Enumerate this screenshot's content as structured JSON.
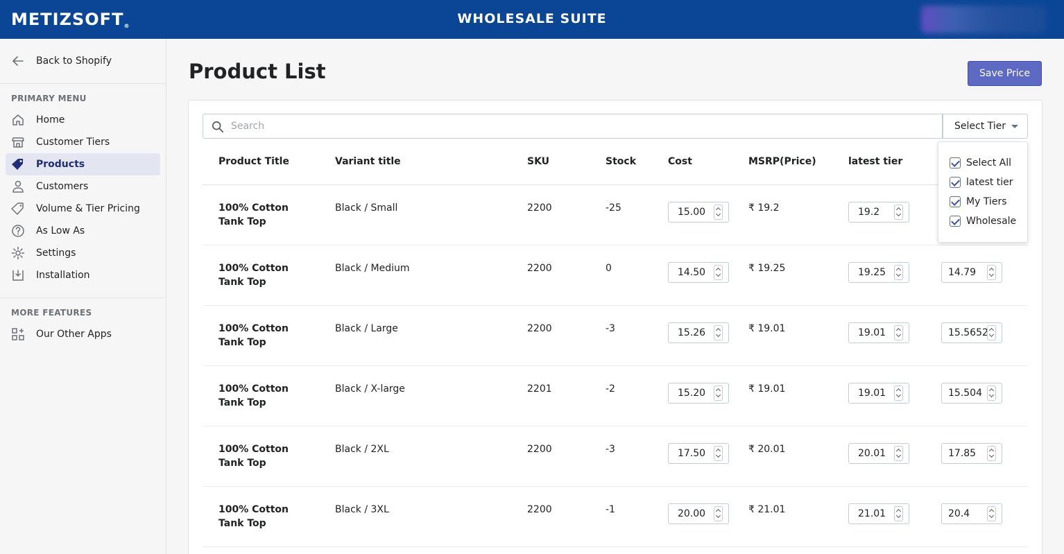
{
  "header": {
    "logo": "METIZSOFT",
    "logo_mark": "®",
    "title": "WHOLESALE SUITE"
  },
  "sidebar": {
    "back_label": "Back to Shopify",
    "primary_title": "PRIMARY MENU",
    "items": [
      {
        "label": "Home",
        "icon": "home-icon"
      },
      {
        "label": "Customer Tiers",
        "icon": "store-icon"
      },
      {
        "label": "Products",
        "icon": "tag-icon",
        "active": true
      },
      {
        "label": "Customers",
        "icon": "person-icon"
      },
      {
        "label": "Volume & Tier Pricing",
        "icon": "price-tag-icon"
      },
      {
        "label": "As Low As",
        "icon": "question-icon"
      },
      {
        "label": "Settings",
        "icon": "gear-icon"
      },
      {
        "label": "Installation",
        "icon": "import-icon"
      }
    ],
    "more_title": "MORE FEATURES",
    "more_items": [
      {
        "label": "Our Other Apps",
        "icon": "apps-icon"
      }
    ]
  },
  "main": {
    "title": "Product List",
    "save_label": "Save Price",
    "search_placeholder": "Search",
    "tier_button": "Select Tier"
  },
  "table": {
    "headers": [
      "Product Title",
      "Variant title",
      "SKU",
      "Stock",
      "Cost",
      "MSRP(Price)",
      "latest tier"
    ],
    "rows": [
      {
        "title1": "100% Cotton",
        "title2": "Tank Top",
        "variant": "Black / Small",
        "sku": "2200",
        "stock": "-25",
        "cost": "15.00",
        "msrp": "₹ 19.2",
        "latest": "19.2",
        "extra": ""
      },
      {
        "title1": "100% Cotton",
        "title2": "Tank Top",
        "variant": "Black / Medium",
        "sku": "2200",
        "stock": "0",
        "cost": "14.50",
        "msrp": "₹ 19.25",
        "latest": "19.25",
        "extra": "14.79"
      },
      {
        "title1": "100% Cotton",
        "title2": "Tank Top",
        "variant": "Black / Large",
        "sku": "2200",
        "stock": "-3",
        "cost": "15.26",
        "msrp": "₹ 19.01",
        "latest": "19.01",
        "extra": "15.5652"
      },
      {
        "title1": "100% Cotton",
        "title2": "Tank Top",
        "variant": "Black / X-large",
        "sku": "2201",
        "stock": "-2",
        "cost": "15.20",
        "msrp": "₹ 19.01",
        "latest": "19.01",
        "extra": "15.504"
      },
      {
        "title1": "100% Cotton",
        "title2": "Tank Top",
        "variant": "Black / 2XL",
        "sku": "2200",
        "stock": "-3",
        "cost": "17.50",
        "msrp": "₹ 20.01",
        "latest": "20.01",
        "extra": "17.85"
      },
      {
        "title1": "100% Cotton",
        "title2": "Tank Top",
        "variant": "Black / 3XL",
        "sku": "2200",
        "stock": "-1",
        "cost": "20.00",
        "msrp": "₹ 21.01",
        "latest": "21.01",
        "extra": "20.4"
      }
    ]
  },
  "tier_dropdown": {
    "options": [
      {
        "label": "Select All",
        "checked": true
      },
      {
        "label": "latest tier",
        "checked": true
      },
      {
        "label": "My Tiers",
        "checked": true
      },
      {
        "label": "Wholesale",
        "checked": true
      }
    ]
  },
  "colors": {
    "topbar": "#0b4696",
    "accent": "#5c6ac4",
    "active_nav": "#e3e6f1"
  }
}
